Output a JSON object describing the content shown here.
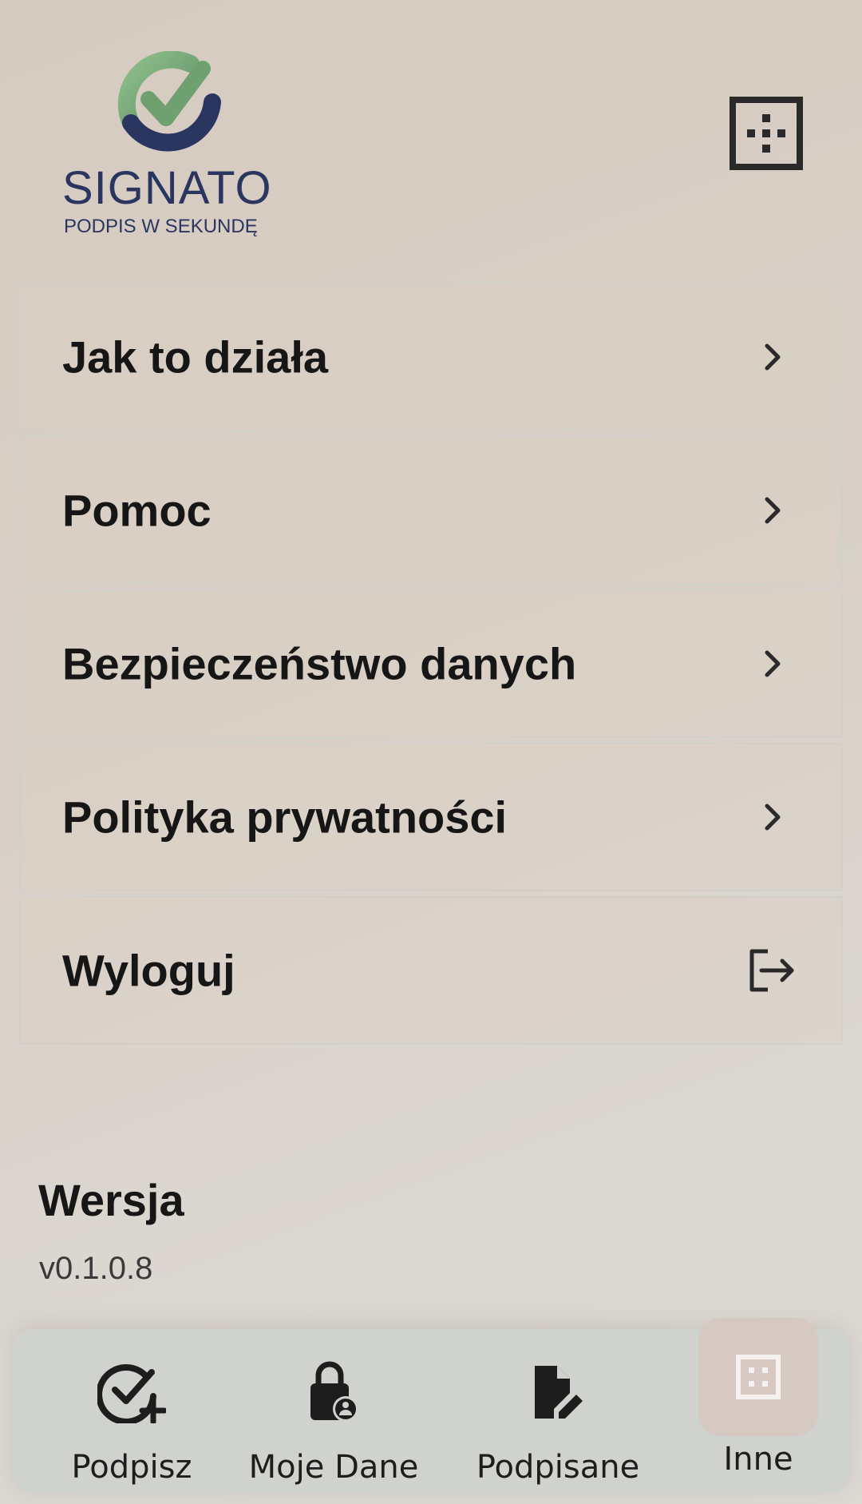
{
  "header": {
    "logo": {
      "name": "SIGNATO",
      "tagline": "PODPIS W SEKUNDĘ",
      "colors": {
        "green_light": "#8fbf8a",
        "green_dark": "#5e8f66",
        "navy": "#2b3660"
      }
    },
    "grid_button_icon": "grid-dots-icon"
  },
  "menu": {
    "items": [
      {
        "label": "Jak to działa",
        "icon": "chevron-right-icon"
      },
      {
        "label": "Pomoc",
        "icon": "chevron-right-icon"
      },
      {
        "label": "Bezpieczeństwo danych",
        "icon": "chevron-right-icon"
      },
      {
        "label": "Polityka prywatności",
        "icon": "chevron-right-icon"
      },
      {
        "label": "Wyloguj",
        "icon": "logout-icon"
      }
    ]
  },
  "version": {
    "title": "Wersja",
    "value": "v0.1.0.8"
  },
  "bottom_nav": {
    "items": [
      {
        "label": "Podpisz",
        "icon": "check-circle-plus-icon",
        "active": false
      },
      {
        "label": "Moje Dane",
        "icon": "lock-user-icon",
        "active": false
      },
      {
        "label": "Podpisane",
        "icon": "document-edit-icon",
        "active": false
      },
      {
        "label": "Inne",
        "icon": "grid-dots-icon",
        "active": true
      }
    ],
    "active_color": "#d6c9c1"
  }
}
